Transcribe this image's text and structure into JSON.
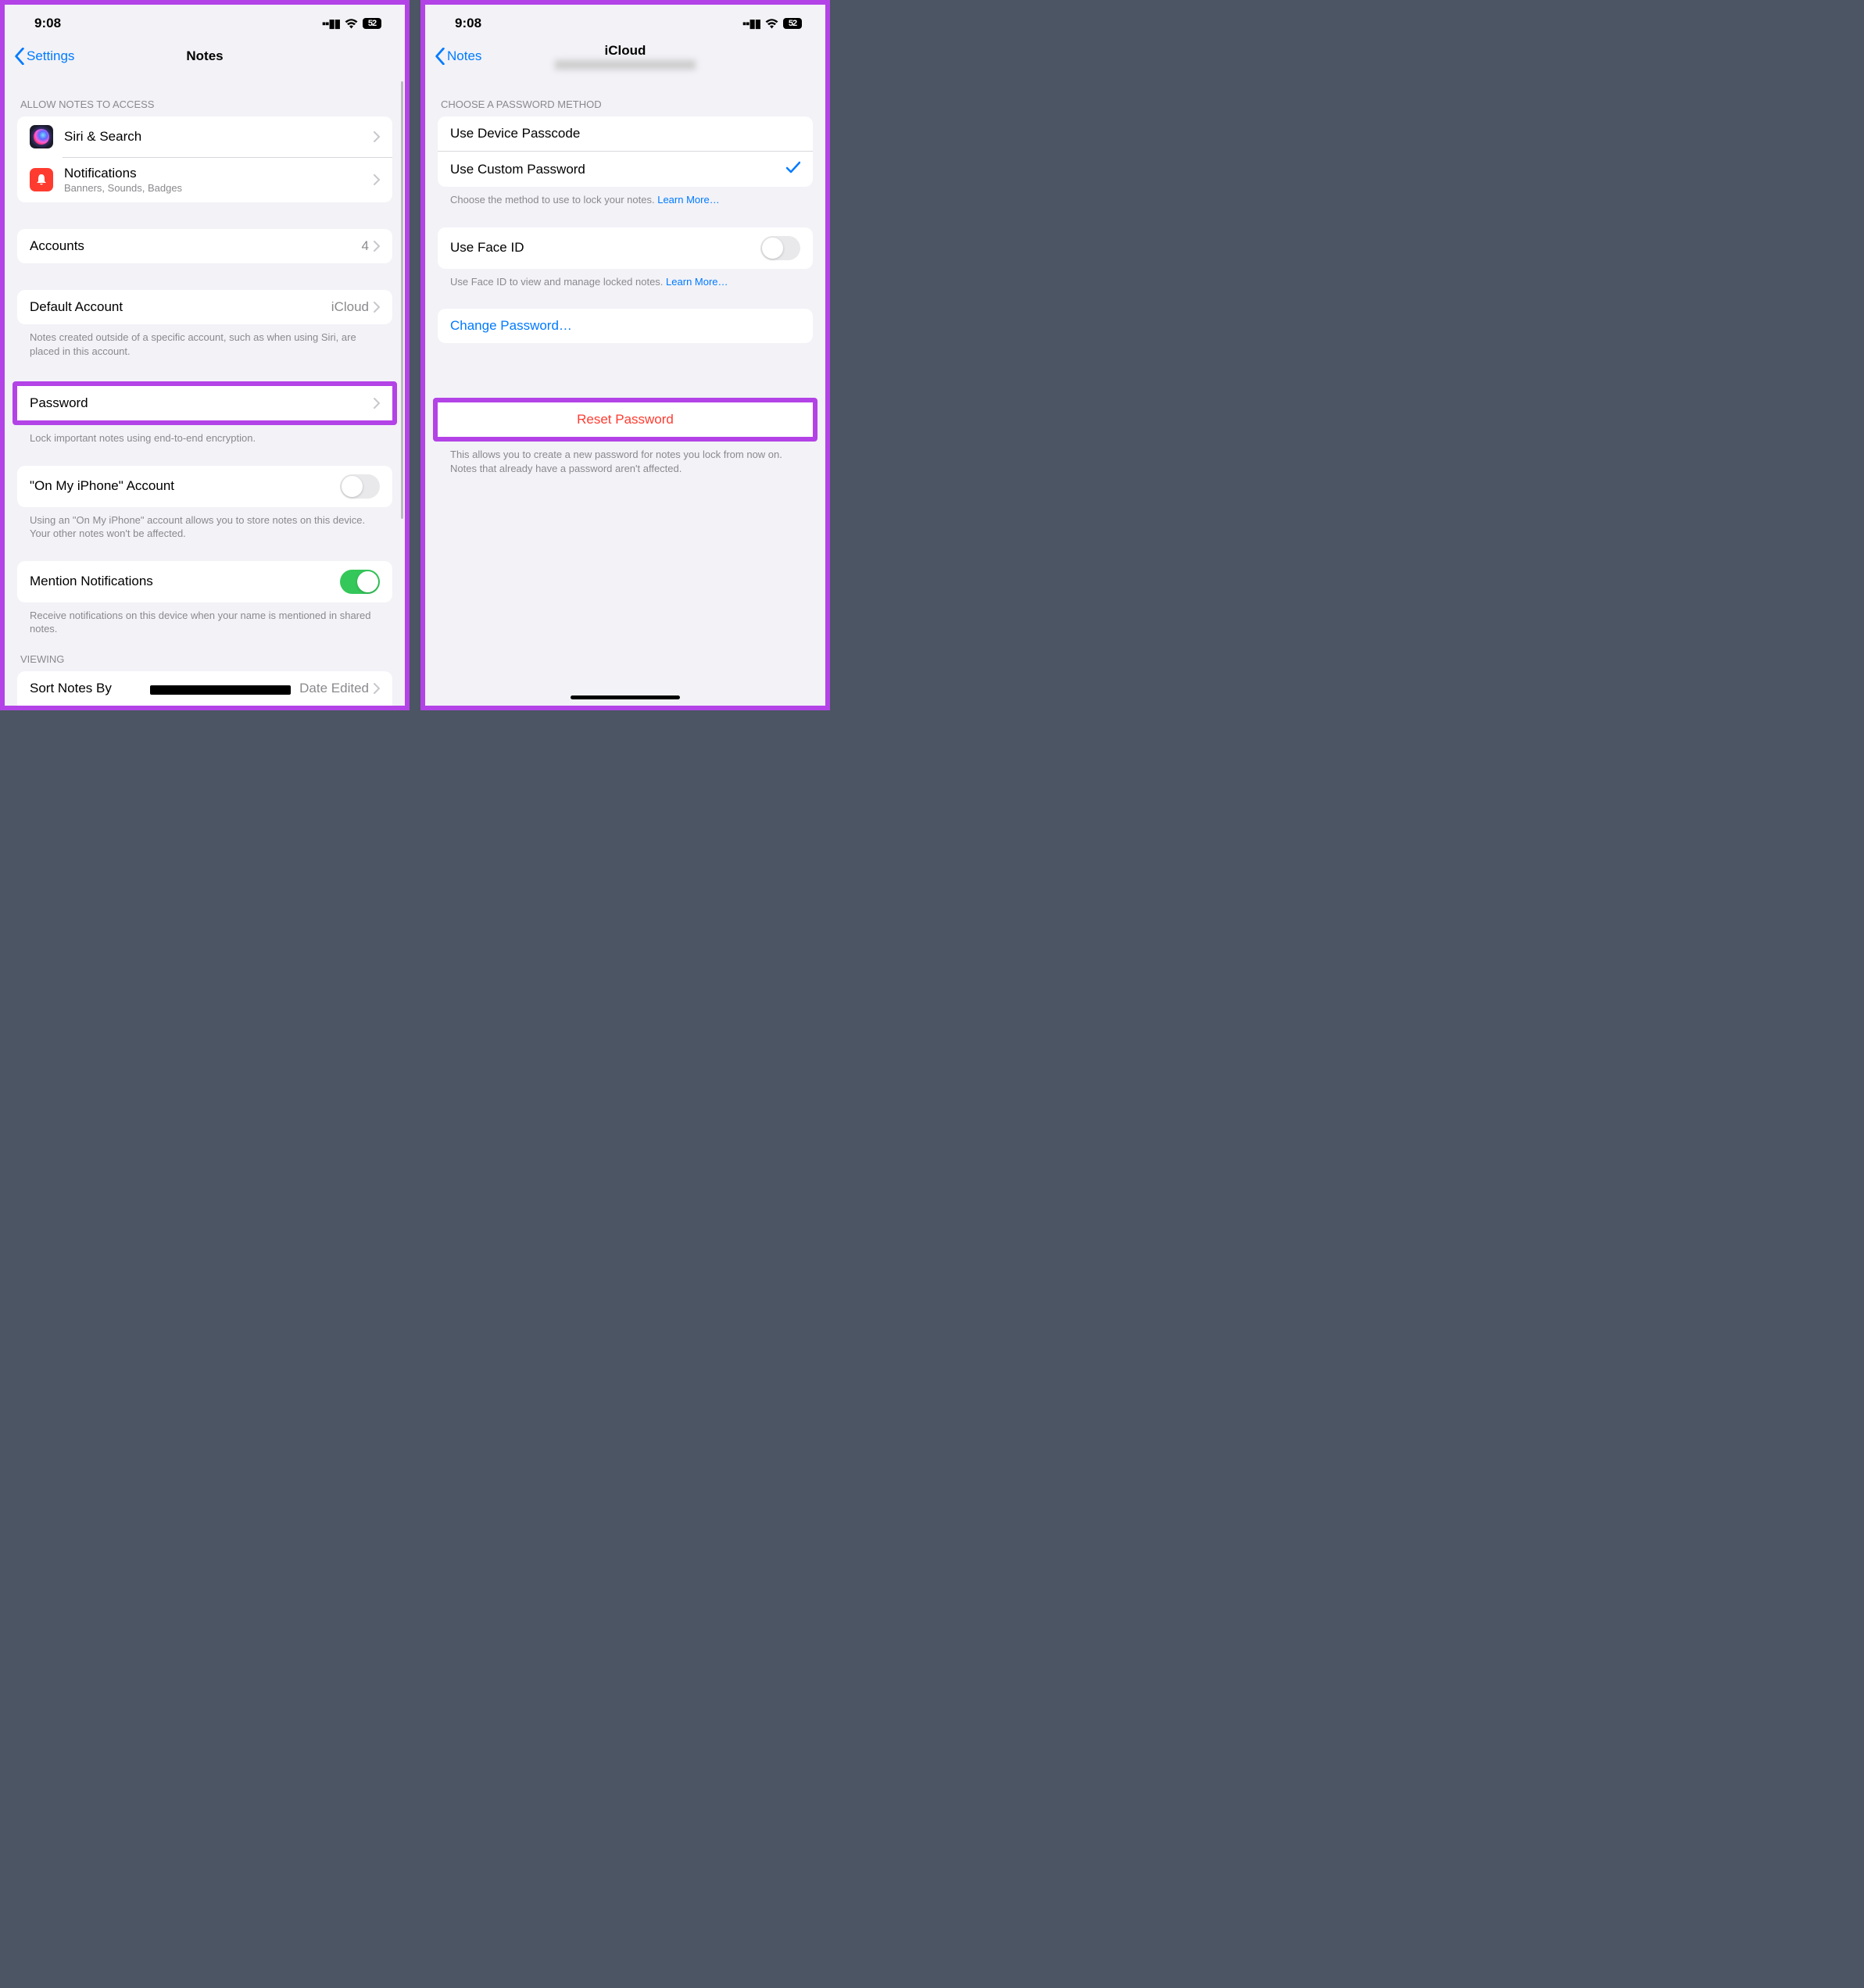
{
  "statusbar": {
    "time": "9:08",
    "battery": "52"
  },
  "left": {
    "back": "Settings",
    "title": "Notes",
    "allow_header": "ALLOW NOTES TO ACCESS",
    "siri": "Siri & Search",
    "notifications": {
      "title": "Notifications",
      "sub": "Banners, Sounds, Badges"
    },
    "accounts": {
      "label": "Accounts",
      "value": "4"
    },
    "default_account": {
      "label": "Default Account",
      "value": "iCloud"
    },
    "default_account_footer": "Notes created outside of a specific account, such as when using Siri, are placed in this account.",
    "password": "Password",
    "password_footer": "Lock important notes using end-to-end encryption.",
    "on_my_iphone": "\"On My iPhone\" Account",
    "on_my_iphone_footer": "Using an \"On My iPhone\" account allows you to store notes on this device. Your other notes won't be affected.",
    "mention": "Mention Notifications",
    "mention_footer": "Receive notifications on this device when your name is mentioned in shared notes.",
    "viewing_header": "VIEWING",
    "sort": {
      "label": "Sort Notes By",
      "value": "Date Edited"
    }
  },
  "right": {
    "back": "Notes",
    "title": "iCloud",
    "choose_header": "CHOOSE A PASSWORD METHOD",
    "device_passcode": "Use Device Passcode",
    "custom_password": "Use Custom Password",
    "method_footer": "Choose the method to use to lock your notes. ",
    "learn_more": "Learn More…",
    "faceid": "Use Face ID",
    "faceid_footer": "Use Face ID to view and manage locked notes. ",
    "change_password": "Change Password…",
    "reset_password": "Reset Password",
    "reset_footer": "This allows you to create a new password for notes you lock from now on. Notes that already have a password aren't affected."
  }
}
